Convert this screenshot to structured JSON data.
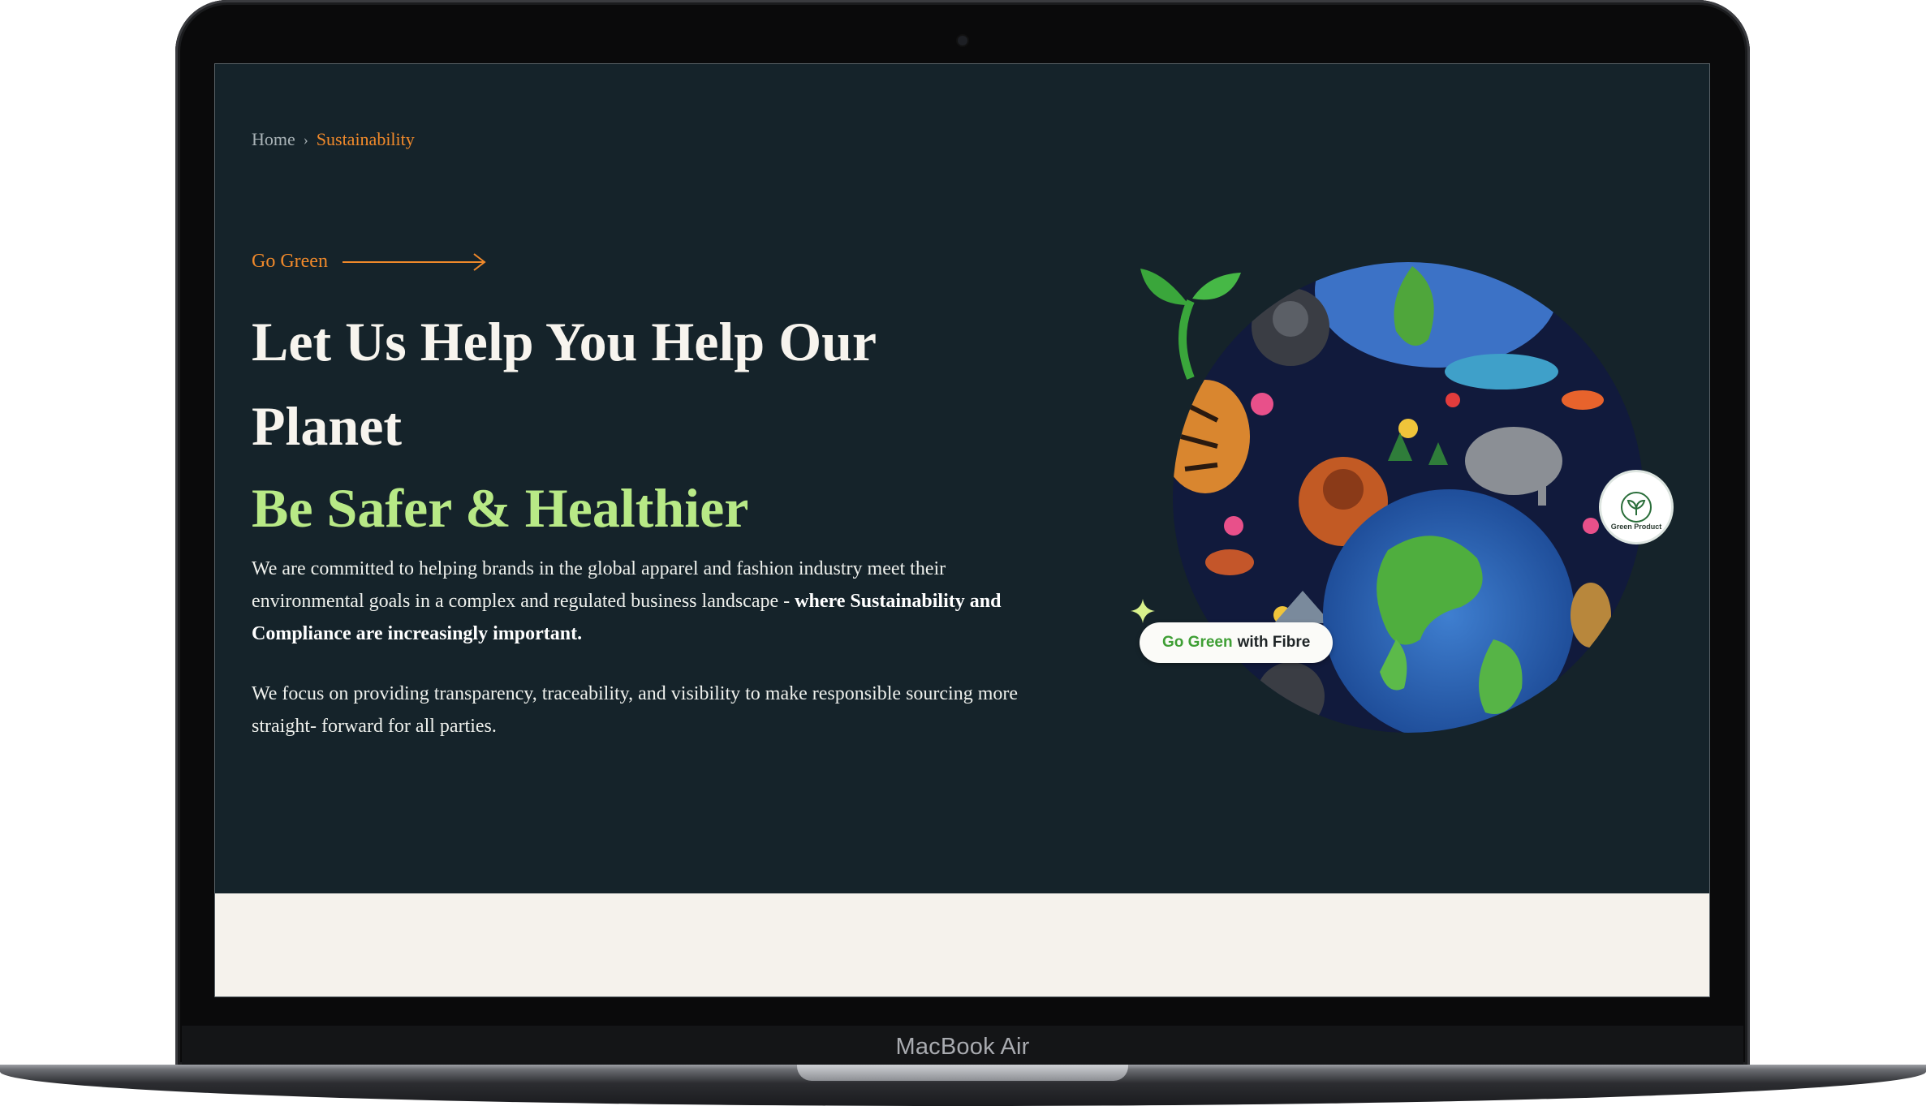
{
  "device": {
    "label": "MacBook Air"
  },
  "breadcrumb": {
    "home": "Home",
    "separator": "›",
    "current": "Sustainability"
  },
  "hero": {
    "kicker": "Go Green",
    "headline": "Let Us Help You Help Our Planet",
    "subhead": "Be Safer & Healthier",
    "paragraph1_plain": "We are committed to helping brands in the global apparel and fashion industry meet their environmental goals in a complex and regulated business landscape - ",
    "paragraph1_bold": "where Sustainability and Compliance are increasingly important.",
    "paragraph2": "We focus on providing transparency, traceability, and visibility to make responsible sourcing more straight- forward for all parties."
  },
  "illustration": {
    "pill_green": "Go Green",
    "pill_rest": "with Fibre",
    "badge_text": "Green Product"
  },
  "colors": {
    "background": "#15232a",
    "accent_orange": "#f0892a",
    "accent_green": "#b8e986",
    "band": "#f5f2ec"
  }
}
